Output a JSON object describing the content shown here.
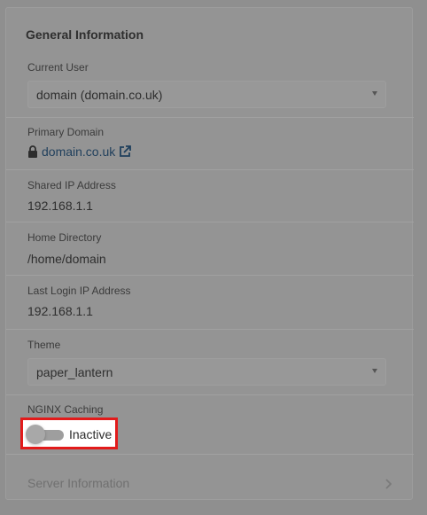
{
  "panel": {
    "title": "General Information",
    "current_user": {
      "label": "Current User",
      "value": "domain (domain.co.uk)"
    },
    "primary_domain": {
      "label": "Primary Domain",
      "value": "domain.co.uk"
    },
    "shared_ip": {
      "label": "Shared IP Address",
      "value": "192.168.1.1"
    },
    "home_directory": {
      "label": "Home Directory",
      "value": "/home/domain"
    },
    "last_login_ip": {
      "label": "Last Login IP Address",
      "value": "192.168.1.1"
    },
    "theme": {
      "label": "Theme",
      "value": "paper_lantern"
    },
    "nginx_caching": {
      "label": "NGINX Caching",
      "state_label": "Inactive",
      "enabled": false
    },
    "server_information": {
      "label": "Server Information"
    }
  },
  "icons": {
    "lock": "lock-icon",
    "external_link": "external-link-icon",
    "chevron_right": "chevron-right-icon",
    "caret_down": "caret-down-icon"
  },
  "colors": {
    "overlay_background": "#8f8f8f",
    "link": "#1f3f5c",
    "highlight_border": "#e21b1b"
  }
}
